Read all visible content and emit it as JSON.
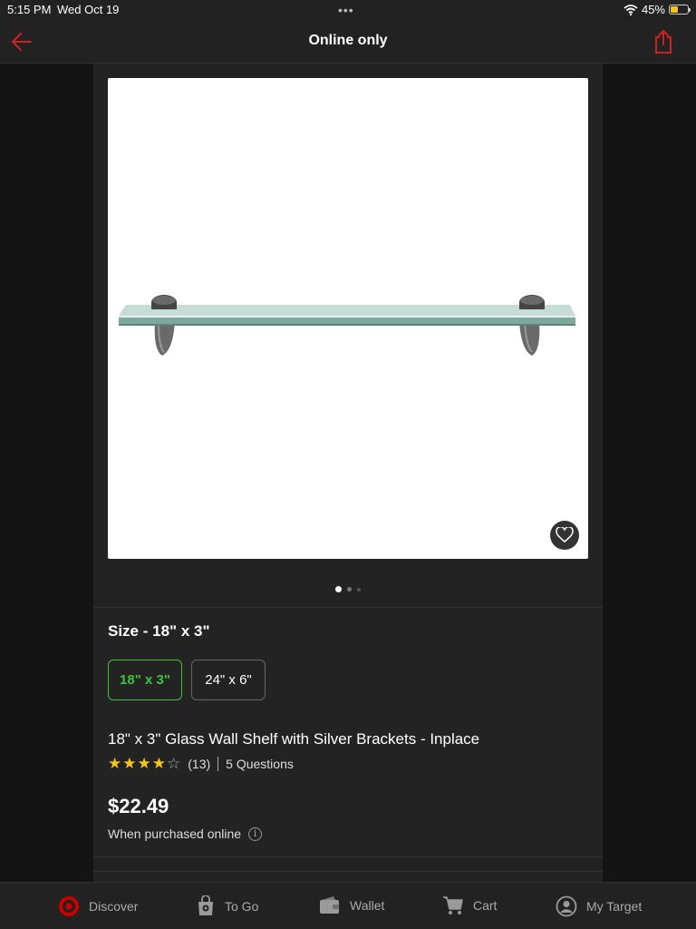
{
  "status_bar": {
    "time": "5:15 PM",
    "date": "Wed Oct 19",
    "battery": "45%",
    "battery_level": 0.45
  },
  "nav": {
    "title": "Online only",
    "back_icon": "arrow-left-icon",
    "share_icon": "share-icon"
  },
  "product": {
    "size_label": "Size - 18\" x 3\"",
    "size_options": [
      {
        "label": "18\" x 3\"",
        "selected": true
      },
      {
        "label": "24\" x 6\"",
        "selected": false
      }
    ],
    "title": "18\" x 3\" Glass Wall Shelf with Silver Brackets - Inplace",
    "rating": 4,
    "rating_max": 5,
    "review_count": "(13)",
    "questions": "5 Questions",
    "price": "$22.49",
    "price_note": "When purchased online",
    "image_pager": {
      "count": 3,
      "active": 0
    }
  },
  "tabs": [
    {
      "label": "Discover",
      "icon": "target-logo-icon"
    },
    {
      "label": "To Go",
      "icon": "shopping-bag-icon"
    },
    {
      "label": "Wallet",
      "icon": "wallet-icon"
    },
    {
      "label": "Cart",
      "icon": "cart-icon"
    },
    {
      "label": "My Target",
      "icon": "user-circle-icon"
    }
  ],
  "colors": {
    "accent": "#cc0000",
    "selected_green": "#3ec23e",
    "star": "#f5c518"
  }
}
